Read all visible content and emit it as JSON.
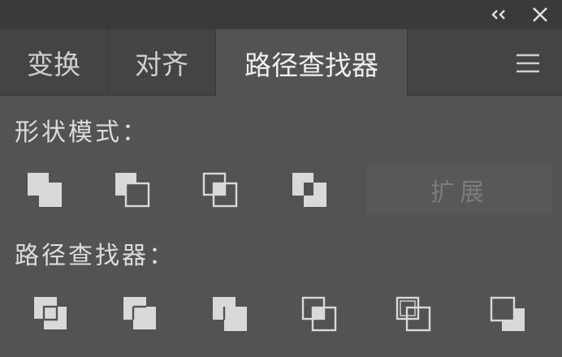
{
  "header": {
    "collapse_icon": "double-chevron-left-icon",
    "close_icon": "close-icon"
  },
  "tabs": [
    {
      "label": "变换",
      "active": false
    },
    {
      "label": "对齐",
      "active": false
    },
    {
      "label": "路径查找器",
      "active": true
    }
  ],
  "menu_icon": "hamburger-menu-icon",
  "shape_modes": {
    "label": "形状模式：",
    "buttons": [
      "unite-icon",
      "minus-front-icon",
      "intersect-icon",
      "exclude-icon"
    ],
    "expand_label": "扩展"
  },
  "pathfinders": {
    "label": "路径查找器：",
    "buttons": [
      "divide-icon",
      "trim-icon",
      "merge-icon",
      "crop-icon",
      "outline-icon",
      "minus-back-icon"
    ]
  },
  "colors": {
    "panel": "#535353",
    "tabbar": "#444444",
    "topbar": "#3a3a3a",
    "icon": "#d9d9d9"
  }
}
